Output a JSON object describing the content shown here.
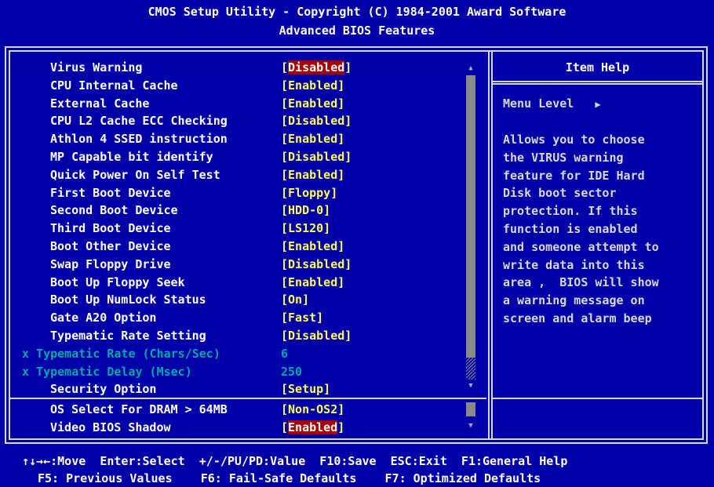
{
  "header": {
    "line1": "CMOS Setup Utility - Copyright (C) 1984-2001 Award Software",
    "line2": "Advanced BIOS Features"
  },
  "settings": [
    {
      "label": "Virus Warning",
      "value": "[Disabled]",
      "selected": true
    },
    {
      "label": "CPU Internal Cache",
      "value": "[Enabled]"
    },
    {
      "label": "External Cache",
      "value": "[Enabled]"
    },
    {
      "label": "CPU L2 Cache ECC Checking",
      "value": "[Disabled]"
    },
    {
      "label": "Athlon 4 SSED instruction",
      "value": "[Enabled]"
    },
    {
      "label": "MP Capable bit identify",
      "value": "[Disabled]"
    },
    {
      "label": "Quick Power On Self Test",
      "value": "[Enabled]"
    },
    {
      "label": "First Boot Device",
      "value": "[Floppy]"
    },
    {
      "label": "Second Boot Device",
      "value": "[HDD-0]"
    },
    {
      "label": "Third Boot Device",
      "value": "[LS120]"
    },
    {
      "label": "Boot Other Device",
      "value": "[Enabled]"
    },
    {
      "label": "Swap Floppy Drive",
      "value": "[Disabled]"
    },
    {
      "label": "Boot Up Floppy Seek",
      "value": "[Enabled]"
    },
    {
      "label": "Boot Up NumLock Status",
      "value": "[On]"
    },
    {
      "label": "Gate A20 Option",
      "value": "[Fast]"
    },
    {
      "label": "Typematic Rate Setting",
      "value": "[Disabled]"
    },
    {
      "label": "x Typematic Rate (Chars/Sec)",
      "value": "6",
      "dim": true
    },
    {
      "label": "x Typematic Delay (Msec)",
      "value": "250",
      "dim": true
    },
    {
      "label": "Security Option",
      "value": "[Setup]"
    }
  ],
  "settings_lower": [
    {
      "label": "OS Select For DRAM > 64MB",
      "value": "[Non-OS2]"
    },
    {
      "label": "Video BIOS Shadow",
      "value": "[Enabled]",
      "selected": true
    }
  ],
  "help": {
    "title": "Item Help",
    "menu_level": "Menu Level",
    "menu_level_icon": "▶",
    "lines": [
      "Allows you to choose",
      "the VIRUS warning",
      "feature for IDE Hard",
      "Disk boot sector",
      "protection. If this",
      "function is enabled",
      "and someone attempt to",
      "write data into this",
      "area ,  BIOS will show",
      "a warning message on",
      "screen and alarm beep"
    ]
  },
  "footer": {
    "line1": "↑↓→←:Move  Enter:Select  +/-/PU/PD:Value  F10:Save  ESC:Exit  F1:General Help",
    "line2": "F5: Previous Values    F6: Fail-Safe Defaults    F7: Optimized Defaults"
  },
  "colors": {
    "background": "#0000a8",
    "value": "#ffff54",
    "disabled": "#00a8a8",
    "highlight": "#a80000"
  }
}
